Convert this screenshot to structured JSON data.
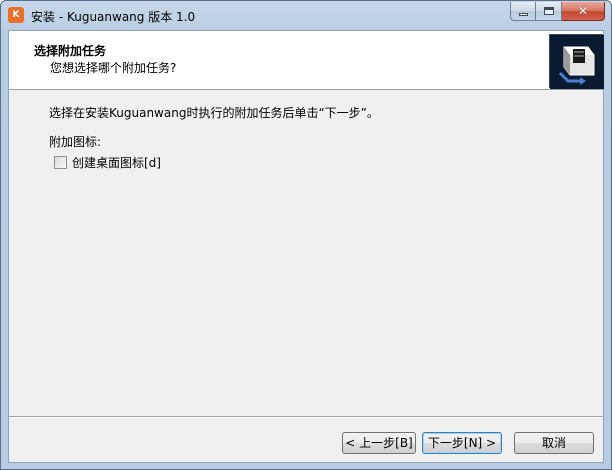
{
  "window": {
    "title": "安装 - Kuguanwang 版本 1.0",
    "icon_text": "K",
    "controls": {
      "minimize": "minimize",
      "maximize": "maximize",
      "close": "✕"
    }
  },
  "header": {
    "title": "选择附加任务",
    "subtitle": "您想选择哪个附加任务?"
  },
  "content": {
    "description": "选择在安装Kuguanwang时执行的附加任务后单击“下一步”。",
    "group_label": "附加图标:",
    "tasks": [
      {
        "label": "创建桌面图标[d]",
        "checked": false
      }
    ]
  },
  "buttons": {
    "back": "< 上一步[B]",
    "next": "下一步[N] >",
    "cancel": "取消"
  },
  "colors": {
    "icon_orange": "#e8702a",
    "close_red": "#c24a34",
    "wizard_bg": "#0a1a30"
  }
}
